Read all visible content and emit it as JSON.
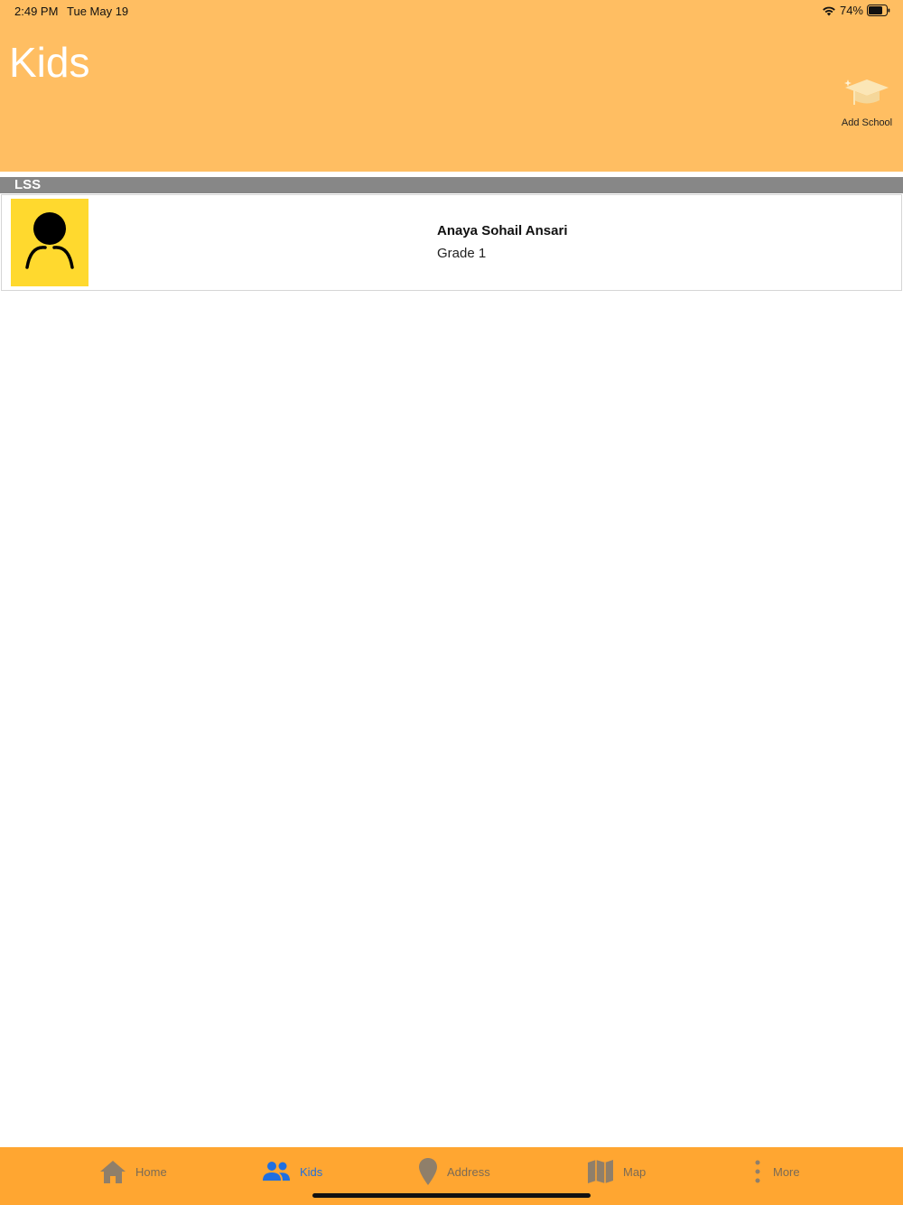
{
  "status_bar": {
    "time": "2:49 PM",
    "date": "Tue May 19",
    "battery": "74%"
  },
  "header": {
    "title": "Kids",
    "add_school_label": "Add School"
  },
  "section": {
    "title": "LSS"
  },
  "kids": [
    {
      "name": "Anaya Sohail Ansari",
      "grade": "Grade 1"
    }
  ],
  "tabs": [
    {
      "label": "Home",
      "icon": "home-icon",
      "active": false
    },
    {
      "label": "Kids",
      "icon": "people-icon",
      "active": true
    },
    {
      "label": "Address",
      "icon": "pin-icon",
      "active": false
    },
    {
      "label": "Map",
      "icon": "map-icon",
      "active": false
    },
    {
      "label": "More",
      "icon": "more-vertical-icon",
      "active": false
    }
  ],
  "colors": {
    "header_bg": "#FFBE62",
    "tab_bar_bg": "#FFA631",
    "active_tab": "#1F6FE0",
    "section_bg": "#878787",
    "avatar_bg": "#FFD92E"
  }
}
